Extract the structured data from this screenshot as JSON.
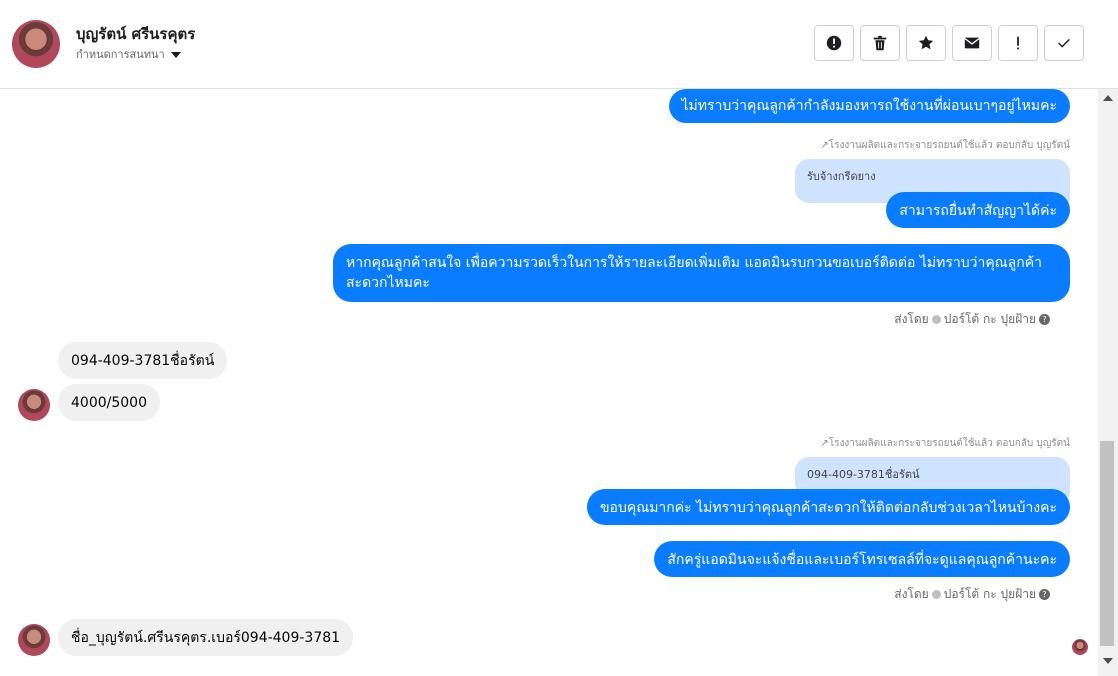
{
  "header": {
    "name": "บุญรัตน์ ศรีนรคุตร",
    "status": "กำหนดการสนทนา",
    "actions": [
      {
        "name": "alert-circle-button",
        "icon": "alert-circle-icon"
      },
      {
        "name": "delete-button",
        "icon": "trash-icon"
      },
      {
        "name": "star-button",
        "icon": "star-icon"
      },
      {
        "name": "mail-button",
        "icon": "envelope-icon"
      },
      {
        "name": "important-button",
        "icon": "exclamation-icon"
      },
      {
        "name": "done-button",
        "icon": "check-icon"
      }
    ]
  },
  "messages": {
    "m1": "ไม่ทราบว่าคุณลูกค้ากำลังมองหารถใช้งานที่ผ่อนเบาๆอยู่ไหมคะ",
    "reply_meta_1": "โรงงานผลิตและกระจายรถยนต์ใช้แล้ว ตอบกลับ บุญรัตน์",
    "quote_1": "รับจ้างกรีดยาง",
    "m2": "สามารถยื่นทำสัญญาได้ค่ะ",
    "m3": "หากคุณลูกค้าสนใจ เพื่อความรวดเร็วในการให้รายละเอียดเพิ่มเติม แอดมินรบกวนขอเบอร์ติดต่อ ไม่ทราบว่าคุณลูกค้า สะดวกไหมคะ",
    "sent_by_1": "ส่งโดย",
    "sender_1": "ปอร์โต้ กะ ปุยฝ้าย",
    "in1": "094-409-3781ชื่อรัตน์",
    "in2": "4000/5000",
    "reply_meta_2": "โรงงานผลิตและกระจายรถยนต์ใช้แล้ว ตอบกลับ บุญรัตน์",
    "quote_2": "094-409-3781ชื่อรัตน์",
    "m4": "ขอบคุณมากค่ะ ไม่ทราบว่าคุณลูกค้าสะดวกให้ติดต่อกลับช่วงเวลาไหนบ้างคะ",
    "m5": "สักครู่แอดมินจะแจ้งชื่อและเบอร์โทรเซลล์ที่จะดูแลคุณลูกค้านะคะ",
    "sent_by_2": "ส่งโดย",
    "sender_2": "ปอร์โต้ กะ ปุยฝ้าย",
    "in3": "ชื่อ_บุญรัตน์.ศรีนรคุตร.เบอร์094-409-3781"
  },
  "colors": {
    "outgoing": "#0a7cff",
    "incoming": "#f0f0f0",
    "quote": "#cfe3ff"
  }
}
